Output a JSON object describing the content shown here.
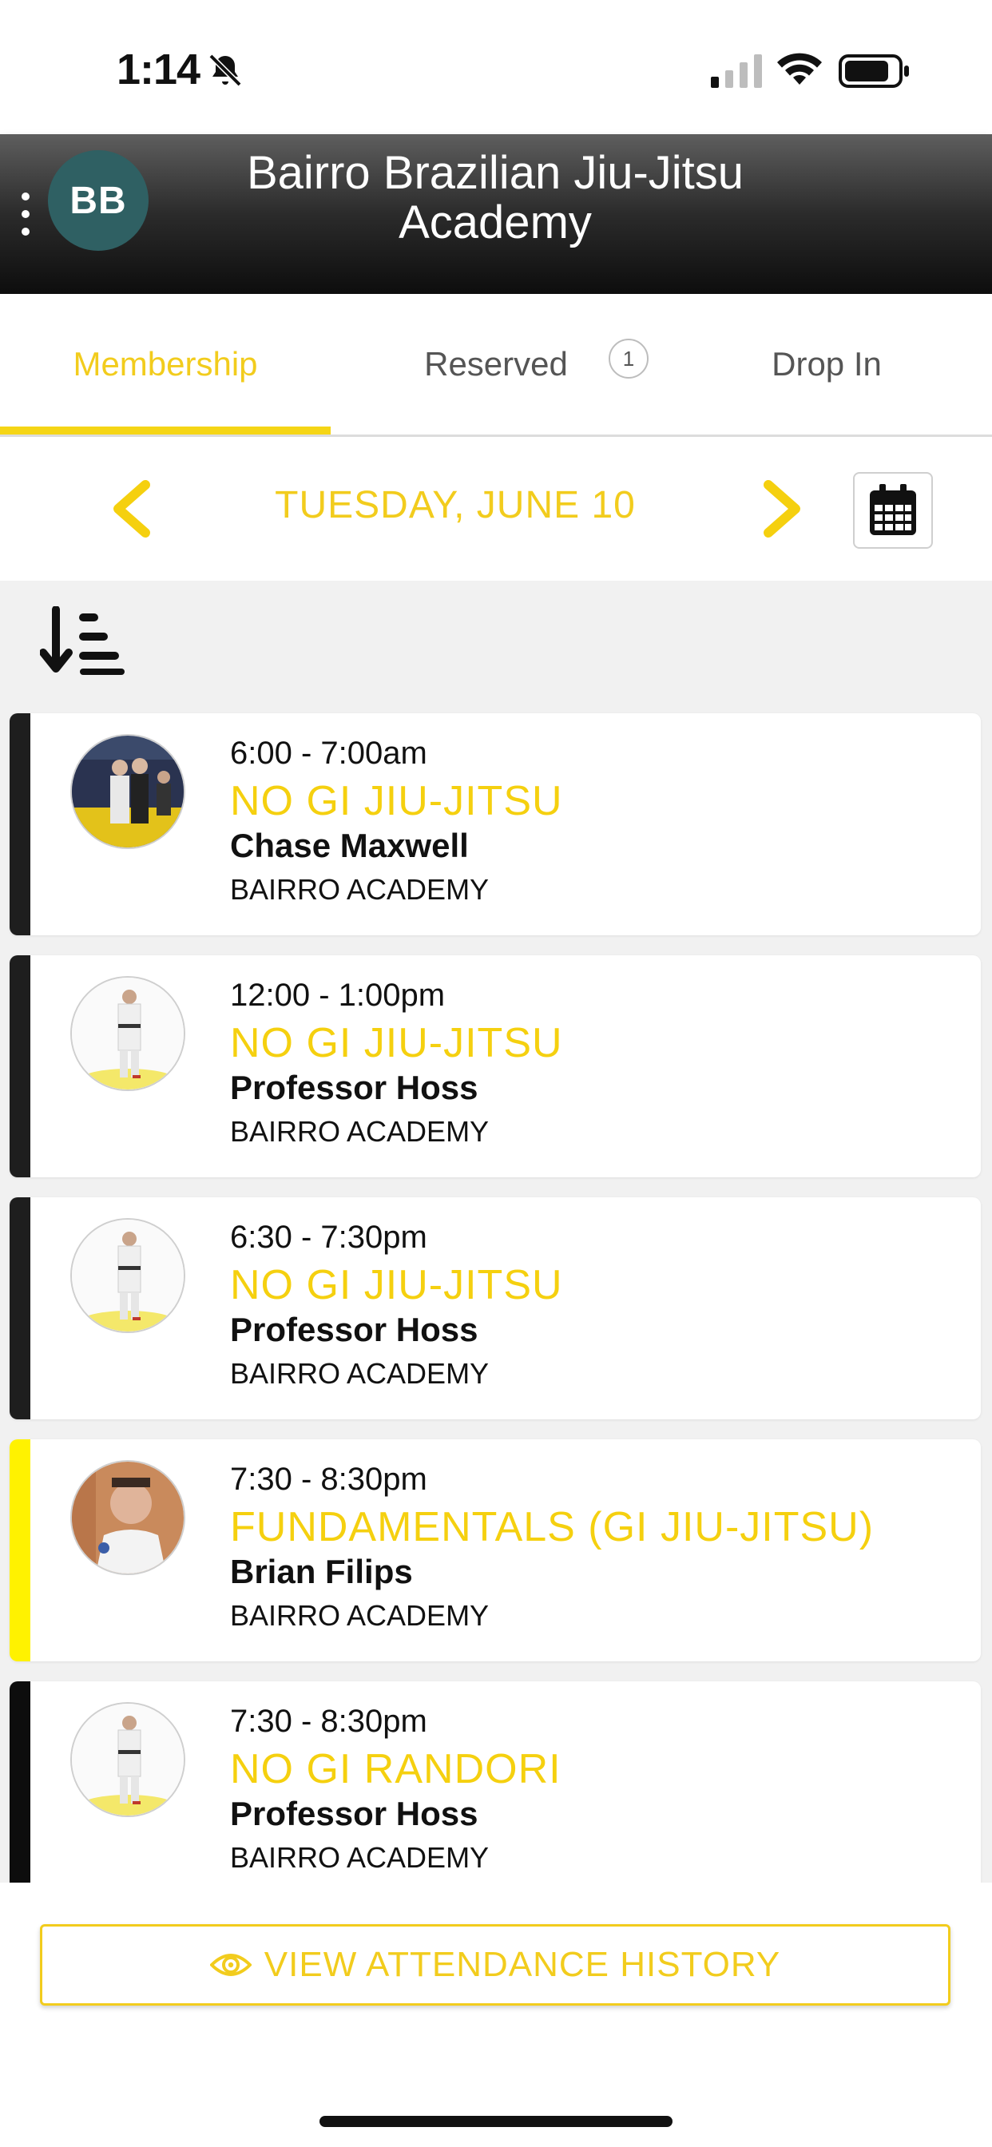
{
  "status_bar": {
    "time": "1:14"
  },
  "header": {
    "avatar_initials": "BB",
    "title_line1": "Bairro Brazilian Jiu-Jitsu",
    "title_line2": "Academy"
  },
  "tabs": [
    {
      "label": "Membership",
      "active": true
    },
    {
      "label": "Reserved",
      "badge": "1",
      "active": false
    },
    {
      "label": "Drop In",
      "active": false
    }
  ],
  "date_nav": {
    "date": "TUESDAY, JUNE 10"
  },
  "classes": [
    {
      "time": "6:00 - 7:00am",
      "name": "NO GI JIU-JITSU",
      "instructor": "Chase Maxwell",
      "location": "BAIRRO ACADEMY",
      "bar_color": "#1e1e1e"
    },
    {
      "time": "12:00 - 1:00pm",
      "name": "NO GI JIU-JITSU",
      "instructor": "Professor Hoss",
      "location": "BAIRRO ACADEMY",
      "bar_color": "#1e1e1e"
    },
    {
      "time": "6:30 - 7:30pm",
      "name": "NO GI JIU-JITSU",
      "instructor": "Professor Hoss",
      "location": "BAIRRO ACADEMY",
      "bar_color": "#1e1e1e"
    },
    {
      "time": "7:30 - 8:30pm",
      "name": "FUNDAMENTALS (GI JIU-JITSU)",
      "instructor": "Brian Filips",
      "location": "BAIRRO ACADEMY",
      "bar_color": "#fff200"
    },
    {
      "time": "7:30 - 8:30pm",
      "name": "NO GI RANDORI",
      "instructor": "Professor Hoss",
      "location": "BAIRRO ACADEMY",
      "bar_color": "#0d0d0d"
    }
  ],
  "footer": {
    "attendance_button": "VIEW ATTENDANCE HISTORY"
  },
  "colors": {
    "accent": "#f2cc1d",
    "header_dark": "#0d0d0d",
    "avatar_bg": "#2f6063"
  }
}
